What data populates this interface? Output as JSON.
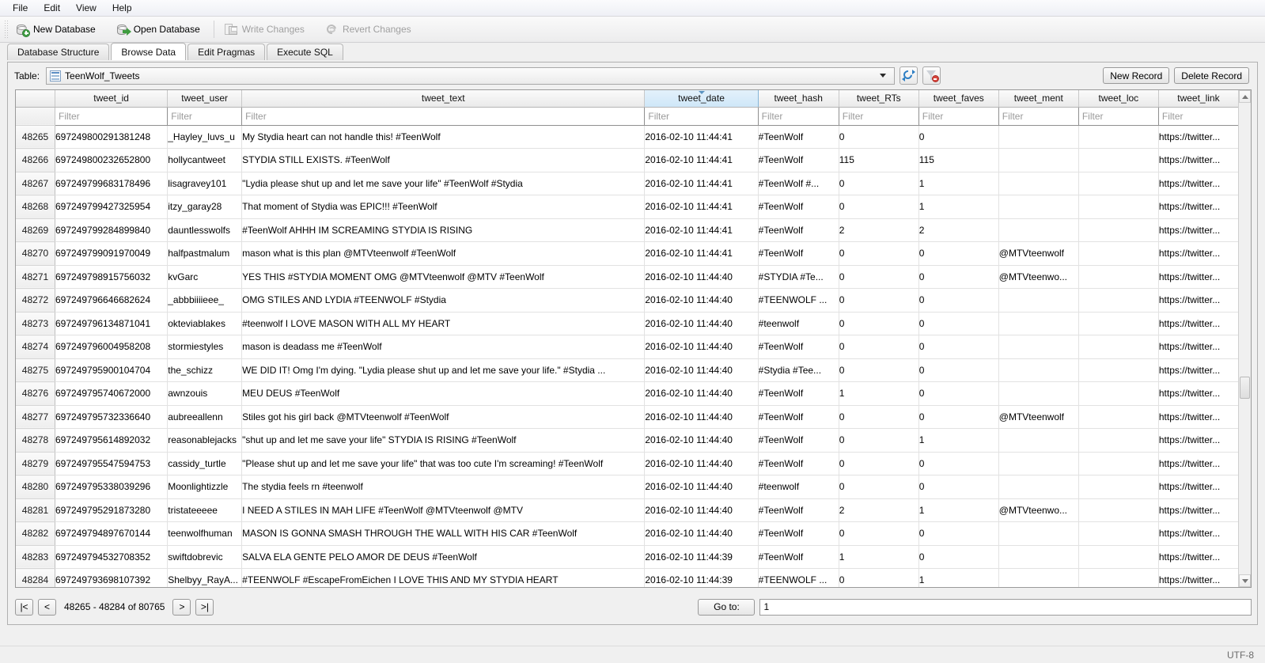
{
  "menu": {
    "items": [
      "File",
      "Edit",
      "View",
      "Help"
    ]
  },
  "toolbar": {
    "new_database": "New Database",
    "open_database": "Open Database",
    "write_changes": "Write Changes",
    "revert_changes": "Revert Changes"
  },
  "tabs": [
    {
      "label": "Database Structure",
      "active": false
    },
    {
      "label": "Browse Data",
      "active": true
    },
    {
      "label": "Edit Pragmas",
      "active": false
    },
    {
      "label": "Execute SQL",
      "active": false
    }
  ],
  "browse": {
    "table_label": "Table:",
    "selected_table": "TeenWolf_Tweets",
    "refresh_icon": "refresh-icon",
    "clear_filter_icon": "clear-filter-icon",
    "new_record": "New Record",
    "delete_record": "Delete Record"
  },
  "grid": {
    "columns": [
      {
        "key": "tweet_id",
        "label": "tweet_id",
        "cls": "c-id",
        "sorted": false
      },
      {
        "key": "tweet_user",
        "label": "tweet_user",
        "cls": "c-user",
        "sorted": false
      },
      {
        "key": "tweet_text",
        "label": "tweet_text",
        "cls": "c-text",
        "sorted": false
      },
      {
        "key": "tweet_date",
        "label": "tweet_date",
        "cls": "c-date",
        "sorted": true
      },
      {
        "key": "tweet_hash",
        "label": "tweet_hash",
        "cls": "c-hash",
        "sorted": false
      },
      {
        "key": "tweet_RTs",
        "label": "tweet_RTs",
        "cls": "c-rts",
        "sorted": false
      },
      {
        "key": "tweet_faves",
        "label": "tweet_faves",
        "cls": "c-faves",
        "sorted": false
      },
      {
        "key": "tweet_ment",
        "label": "tweet_ment",
        "cls": "c-ment",
        "sorted": false
      },
      {
        "key": "tweet_loc",
        "label": "tweet_loc",
        "cls": "c-loc",
        "sorted": false
      },
      {
        "key": "tweet_link",
        "label": "tweet_link",
        "cls": "c-link",
        "sorted": false
      }
    ],
    "filter_placeholder": "Filter",
    "rows": [
      {
        "n": "48265",
        "tweet_id": "697249800291381248",
        "tweet_user": "_Hayley_luvs_u",
        "tweet_text": "My Stydia heart can not handle this! #TeenWolf",
        "tweet_date": "2016-02-10 11:44:41",
        "tweet_hash": "#TeenWolf",
        "tweet_RTs": "0",
        "tweet_faves": "0",
        "tweet_ment": "",
        "tweet_loc": "",
        "tweet_link": "https://twitter..."
      },
      {
        "n": "48266",
        "tweet_id": "697249800232652800",
        "tweet_user": "hollycantweet",
        "tweet_text": "STYDIA STILL EXISTS. #TeenWolf",
        "tweet_date": "2016-02-10 11:44:41",
        "tweet_hash": "#TeenWolf",
        "tweet_RTs": "115",
        "tweet_faves": "115",
        "tweet_ment": "",
        "tweet_loc": "",
        "tweet_link": "https://twitter..."
      },
      {
        "n": "48267",
        "tweet_id": "697249799683178496",
        "tweet_user": "lisagravey101",
        "tweet_text": "\"Lydia please shut up and let me save your life\" #TeenWolf #Stydia",
        "tweet_date": "2016-02-10 11:44:41",
        "tweet_hash": "#TeenWolf #...",
        "tweet_RTs": "0",
        "tweet_faves": "1",
        "tweet_ment": "",
        "tweet_loc": "",
        "tweet_link": "https://twitter..."
      },
      {
        "n": "48268",
        "tweet_id": "697249799427325954",
        "tweet_user": "itzy_garay28",
        "tweet_text": "That moment of Stydia was EPIC!!! #TeenWolf",
        "tweet_date": "2016-02-10 11:44:41",
        "tweet_hash": "#TeenWolf",
        "tweet_RTs": "0",
        "tweet_faves": "1",
        "tweet_ment": "",
        "tweet_loc": "",
        "tweet_link": "https://twitter..."
      },
      {
        "n": "48269",
        "tweet_id": "697249799284899840",
        "tweet_user": "dauntlesswolfs",
        "tweet_text": "#TeenWolf AHHH IM SCREAMING STYDIA IS RISING",
        "tweet_date": "2016-02-10 11:44:41",
        "tweet_hash": "#TeenWolf",
        "tweet_RTs": "2",
        "tweet_faves": "2",
        "tweet_ment": "",
        "tweet_loc": "",
        "tweet_link": "https://twitter..."
      },
      {
        "n": "48270",
        "tweet_id": "697249799091970049",
        "tweet_user": "halfpastmalum",
        "tweet_text": "mason what is this plan @MTVteenwolf #TeenWolf",
        "tweet_date": "2016-02-10 11:44:41",
        "tweet_hash": "#TeenWolf",
        "tweet_RTs": "0",
        "tweet_faves": "0",
        "tweet_ment": "@MTVteenwolf",
        "tweet_loc": "",
        "tweet_link": "https://twitter..."
      },
      {
        "n": "48271",
        "tweet_id": "697249798915756032",
        "tweet_user": "kvGarc",
        "tweet_text": "YES THIS #STYDIA MOMENT OMG @MTVteenwolf @MTV #TeenWolf",
        "tweet_date": "2016-02-10 11:44:40",
        "tweet_hash": "#STYDIA #Te...",
        "tweet_RTs": "0",
        "tweet_faves": "0",
        "tweet_ment": "@MTVteenwo...",
        "tweet_loc": "",
        "tweet_link": "https://twitter..."
      },
      {
        "n": "48272",
        "tweet_id": "697249796646682624",
        "tweet_user": "_abbbiiiieee_",
        "tweet_text": "OMG STILES AND LYDIA #TEENWOLF #Stydia",
        "tweet_date": "2016-02-10 11:44:40",
        "tweet_hash": "#TEENWOLF ...",
        "tweet_RTs": "0",
        "tweet_faves": "0",
        "tweet_ment": "",
        "tweet_loc": "",
        "tweet_link": "https://twitter..."
      },
      {
        "n": "48273",
        "tweet_id": "697249796134871041",
        "tweet_user": "okteviablakes",
        "tweet_text": "#teenwolf I LOVE MASON WITH ALL MY HEART",
        "tweet_date": "2016-02-10 11:44:40",
        "tweet_hash": "#teenwolf",
        "tweet_RTs": "0",
        "tweet_faves": "0",
        "tweet_ment": "",
        "tweet_loc": "",
        "tweet_link": "https://twitter..."
      },
      {
        "n": "48274",
        "tweet_id": "697249796004958208",
        "tweet_user": "stormiestyles",
        "tweet_text": "mason is deadass me #TeenWolf",
        "tweet_date": "2016-02-10 11:44:40",
        "tweet_hash": "#TeenWolf",
        "tweet_RTs": "0",
        "tweet_faves": "0",
        "tweet_ment": "",
        "tweet_loc": "",
        "tweet_link": "https://twitter..."
      },
      {
        "n": "48275",
        "tweet_id": "697249795900104704",
        "tweet_user": "the_schizz",
        "tweet_text": "WE DID IT! Omg I'm dying. \"Lydia please shut up and let me save your life.\" #Stydia ...",
        "tweet_date": "2016-02-10 11:44:40",
        "tweet_hash": "#Stydia #Tee...",
        "tweet_RTs": "0",
        "tweet_faves": "0",
        "tweet_ment": "",
        "tweet_loc": "",
        "tweet_link": "https://twitter..."
      },
      {
        "n": "48276",
        "tweet_id": "697249795740672000",
        "tweet_user": "awnzouis",
        "tweet_text": "MEU DEUS #TeenWolf",
        "tweet_date": "2016-02-10 11:44:40",
        "tweet_hash": "#TeenWolf",
        "tweet_RTs": "1",
        "tweet_faves": "0",
        "tweet_ment": "",
        "tweet_loc": "",
        "tweet_link": "https://twitter..."
      },
      {
        "n": "48277",
        "tweet_id": "697249795732336640",
        "tweet_user": "aubreeallenn",
        "tweet_text": "Stiles got his girl back @MTVteenwolf #TeenWolf",
        "tweet_date": "2016-02-10 11:44:40",
        "tweet_hash": "#TeenWolf",
        "tweet_RTs": "0",
        "tweet_faves": "0",
        "tweet_ment": "@MTVteenwolf",
        "tweet_loc": "",
        "tweet_link": "https://twitter..."
      },
      {
        "n": "48278",
        "tweet_id": "697249795614892032",
        "tweet_user": "reasonablejacks",
        "tweet_text": "\"shut up and let me save your life\" STYDIA IS RISING #TeenWolf",
        "tweet_date": "2016-02-10 11:44:40",
        "tweet_hash": "#TeenWolf",
        "tweet_RTs": "0",
        "tweet_faves": "1",
        "tweet_ment": "",
        "tweet_loc": "",
        "tweet_link": "https://twitter..."
      },
      {
        "n": "48279",
        "tweet_id": "697249795547594753",
        "tweet_user": "cassidy_turtle",
        "tweet_text": "\"Please shut up and let me save your life\" that was too cute I'm screaming! #TeenWolf",
        "tweet_date": "2016-02-10 11:44:40",
        "tweet_hash": "#TeenWolf",
        "tweet_RTs": "0",
        "tweet_faves": "0",
        "tweet_ment": "",
        "tweet_loc": "",
        "tweet_link": "https://twitter..."
      },
      {
        "n": "48280",
        "tweet_id": "697249795338039296",
        "tweet_user": "Moonlightizzle",
        "tweet_text": "The stydia feels rn #teenwolf",
        "tweet_date": "2016-02-10 11:44:40",
        "tweet_hash": "#teenwolf",
        "tweet_RTs": "0",
        "tweet_faves": "0",
        "tweet_ment": "",
        "tweet_loc": "",
        "tweet_link": "https://twitter..."
      },
      {
        "n": "48281",
        "tweet_id": "697249795291873280",
        "tweet_user": "tristateeeee",
        "tweet_text": "I NEED A STILES IN MAH LIFE #TeenWolf @MTVteenwolf @MTV",
        "tweet_date": "2016-02-10 11:44:40",
        "tweet_hash": "#TeenWolf",
        "tweet_RTs": "2",
        "tweet_faves": "1",
        "tweet_ment": "@MTVteenwo...",
        "tweet_loc": "",
        "tweet_link": "https://twitter..."
      },
      {
        "n": "48282",
        "tweet_id": "697249794897670144",
        "tweet_user": "teenwolfhuman",
        "tweet_text": "MASON IS GONNA SMASH THROUGH THE WALL WITH HIS CAR #TeenWolf",
        "tweet_date": "2016-02-10 11:44:40",
        "tweet_hash": "#TeenWolf",
        "tweet_RTs": "0",
        "tweet_faves": "0",
        "tweet_ment": "",
        "tweet_loc": "",
        "tweet_link": "https://twitter..."
      },
      {
        "n": "48283",
        "tweet_id": "697249794532708352",
        "tweet_user": "swiftdobrevic",
        "tweet_text": "SALVA ELA GENTE PELO AMOR DE DEUS #TeenWolf",
        "tweet_date": "2016-02-10 11:44:39",
        "tweet_hash": "#TeenWolf",
        "tweet_RTs": "1",
        "tweet_faves": "0",
        "tweet_ment": "",
        "tweet_loc": "",
        "tweet_link": "https://twitter..."
      },
      {
        "n": "48284",
        "tweet_id": "697249793698107392",
        "tweet_user": "Shelbyy_RayA...",
        "tweet_text": "#TEENWOLF #EscapeFromEichen I LOVE THIS AND MY STYDIA HEART",
        "tweet_date": "2016-02-10 11:44:39",
        "tweet_hash": "#TEENWOLF ...",
        "tweet_RTs": "0",
        "tweet_faves": "1",
        "tweet_ment": "",
        "tweet_loc": "",
        "tweet_link": "https://twitter..."
      }
    ]
  },
  "pager": {
    "first": "|<",
    "prev": "<",
    "range": "48265 - 48284 of 80765",
    "next": ">",
    "last": ">|",
    "goto_label": "Go to:",
    "goto_value": "1"
  },
  "status": {
    "encoding": "UTF-8"
  },
  "colors": {
    "sorted_header": "#cfe7f8",
    "accent_blue": "#2f7fc4",
    "badge_green": "#43a047",
    "filter_red": "#d8443c"
  }
}
